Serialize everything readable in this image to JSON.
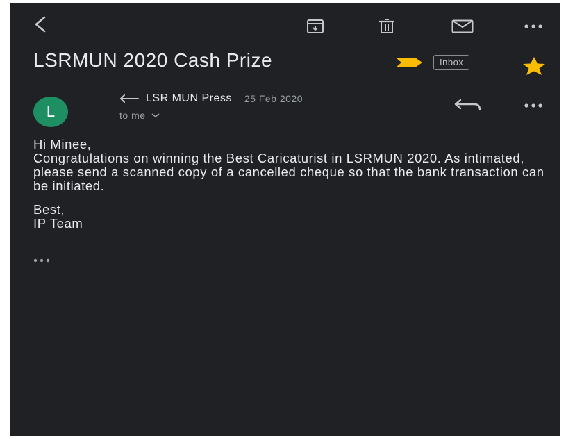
{
  "toolbar": {
    "back_icon": "back-arrow-icon",
    "archive_icon": "archive-icon",
    "delete_icon": "trash-icon",
    "mark_unread_icon": "envelope-icon",
    "more_icon": "more-horizontal-icon"
  },
  "email": {
    "subject": "LSRMUN 2020 Cash Prize",
    "label": "Inbox",
    "starred": true,
    "important": true,
    "colors": {
      "background": "#202124",
      "important": "#fbbc04",
      "star": "#fbbc04",
      "avatar": "#1e8e63"
    }
  },
  "message": {
    "avatar_letter": "L",
    "sender": "LSR MUN Press",
    "date": "25 Feb 2020",
    "recipient": "to me",
    "body": [
      "Hi Minee,",
      "Congratulations on winning the Best Caricaturist in LSRMUN 2020. As intimated, please send a scanned copy of a cancelled cheque so that the bank transaction can be initiated."
    ],
    "signature": [
      "Best,",
      "IP Team"
    ]
  }
}
